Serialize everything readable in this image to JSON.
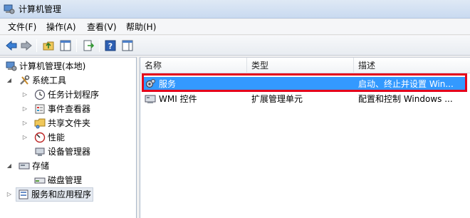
{
  "window": {
    "title": "计算机管理"
  },
  "menu": [
    "文件(F)",
    "操作(A)",
    "查看(V)",
    "帮助(H)"
  ],
  "toolbar": {
    "buttons": [
      "back-icon",
      "forward-icon",
      "up-folder-icon",
      "show-hide-tree-icon",
      "export-list-icon",
      "help-icon",
      "show-hide-action-pane-icon"
    ]
  },
  "tree": {
    "root": "计算机管理(本地)",
    "system_tools": "系统工具",
    "task_scheduler": "任务计划程序",
    "event_viewer": "事件查看器",
    "shared_folders": "共享文件夹",
    "performance": "性能",
    "device_manager": "设备管理器",
    "storage": "存储",
    "disk_management": "磁盘管理",
    "services_apps": "服务和应用程序"
  },
  "list": {
    "columns": [
      "名称",
      "类型",
      "描述"
    ],
    "rows": [
      {
        "name": "服务",
        "type": "",
        "desc": "启动、终止并设置 Win..."
      },
      {
        "name": "WMI 控件",
        "type": "扩展管理单元",
        "desc": "配置和控制 Windows ..."
      }
    ]
  },
  "colors": {
    "selection": "#3399ff",
    "highlight": "#e4001b"
  }
}
